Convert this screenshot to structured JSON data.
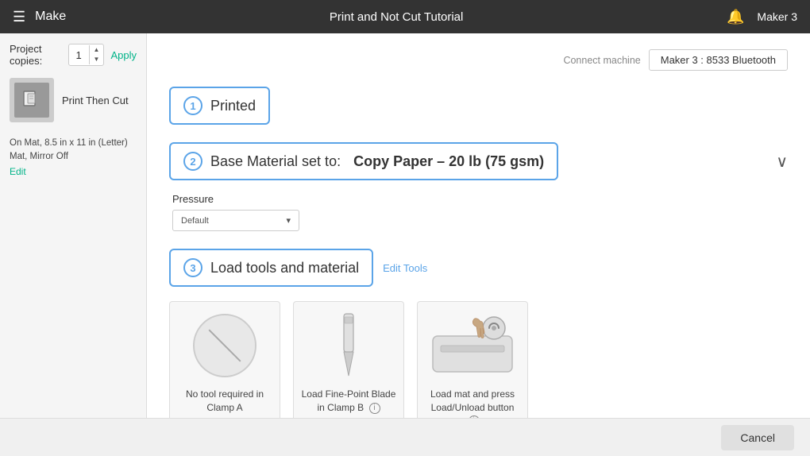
{
  "header": {
    "menu_icon": "☰",
    "make_label": "Make",
    "title": "Print and Not Cut Tutorial",
    "bell_icon": "🔔",
    "device_name": "Maker 3"
  },
  "left_panel": {
    "project_copies_label": "Project copies:",
    "copies_value": "1",
    "apply_label": "Apply",
    "project_name": "Print Then Cut",
    "mat_info": "On Mat, 8.5 in x 11 in (Letter) Mat, Mirror Off",
    "edit_label": "Edit"
  },
  "connect_bar": {
    "connect_label": "Connect machine",
    "machine_name": "Maker 3 : 8533 Bluetooth"
  },
  "step1": {
    "number": "1",
    "title": "Printed"
  },
  "step2": {
    "number": "2",
    "prefix": "Base Material set to:",
    "material": "Copy Paper – 20 lb (75 gsm)",
    "pressure_label": "Pressure",
    "pressure_value": "Default",
    "chevron": "∨"
  },
  "step3": {
    "number": "3",
    "title": "Load tools and material",
    "edit_tools_label": "Edit Tools",
    "tools": [
      {
        "type": "no-tool",
        "label": "No tool required in Clamp A",
        "has_info": false
      },
      {
        "type": "fine-point-blade",
        "label": "Load Fine-Point Blade in Clamp B",
        "has_info": true
      },
      {
        "type": "load-mat",
        "label": "Load mat and press Load/Unload button",
        "has_info": true
      }
    ]
  },
  "bottom": {
    "cancel_label": "Cancel"
  }
}
